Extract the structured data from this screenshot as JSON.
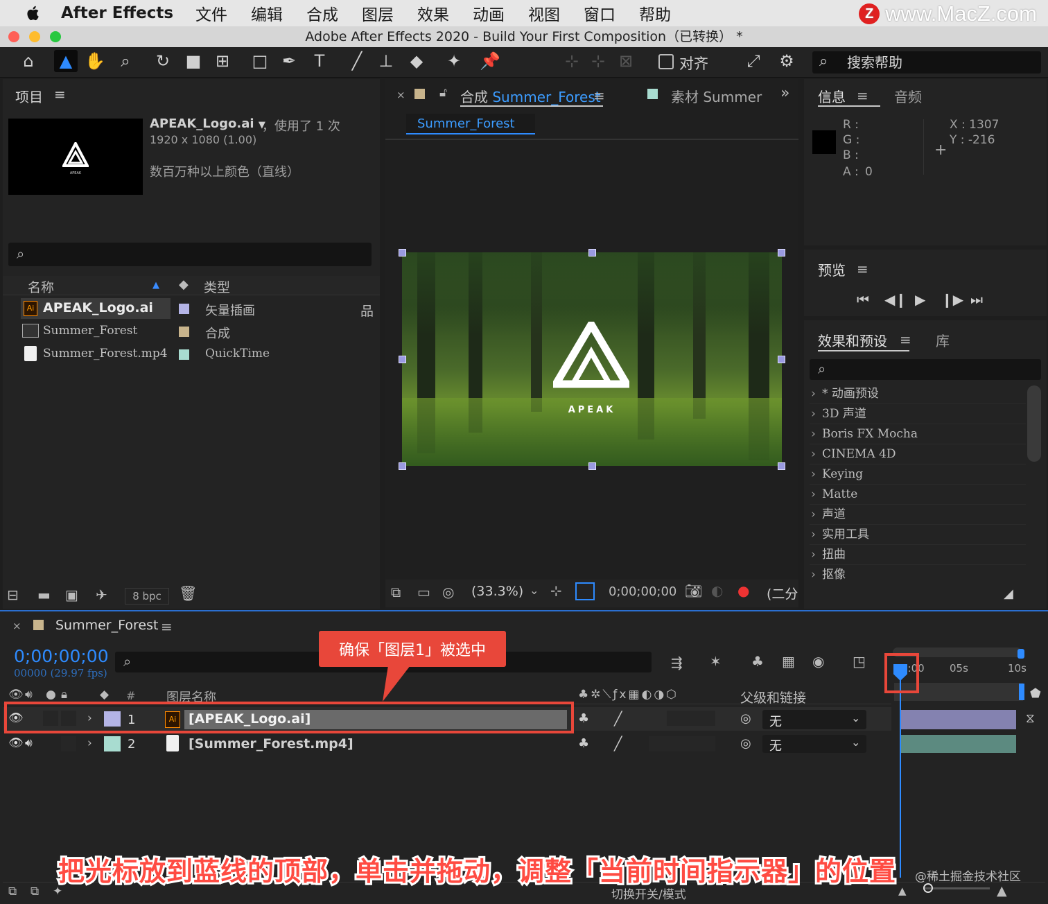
{
  "menubar": {
    "app_name": "After Effects",
    "items": [
      "文件",
      "编辑",
      "合成",
      "图层",
      "效果",
      "动画",
      "视图",
      "窗口",
      "帮助"
    ],
    "watermark": "www.MacZ.com",
    "watermark_logo": "Z"
  },
  "window": {
    "title": "Adobe After Effects 2020 - Build Your First Composition（已转换） *"
  },
  "toolbar": {
    "snap_label": "对齐",
    "search_help_label": "搜索帮助",
    "tools": [
      "home-icon",
      "selection-arrow-icon",
      "hand-icon",
      "zoom-icon",
      "rotate-icon",
      "camera-icon",
      "pan-behind-icon",
      "rectangle-icon",
      "pen-icon",
      "type-icon",
      "brush-icon",
      "clone-stamp-icon",
      "eraser-icon",
      "roto-brush-icon",
      "puppet-pin-icon"
    ]
  },
  "project_panel": {
    "title": "项目",
    "selected_item": {
      "name": "APEAK_Logo.ai",
      "usage": "，使用了 1 次",
      "dimensions": "1920 x 1080 (1.00)",
      "colors": "数百万种以上颜色（直线）",
      "thumb_text": "APEAK"
    },
    "columns": {
      "name": "名称",
      "type": "类型"
    },
    "items": [
      {
        "name": "APEAK_Logo.ai",
        "type": "矢量插画",
        "color": "#b4b4e6",
        "icon": "ai-file-icon"
      },
      {
        "name": "Summer_Forest",
        "type": "合成",
        "color": "#c8b48c",
        "icon": "composition-icon"
      },
      {
        "name": "Summer_Forest.mp4",
        "type": "QuickTime",
        "color": "#a8dcd0",
        "icon": "quicktime-icon"
      }
    ],
    "bpc_label": "8 bpc"
  },
  "composition_panel": {
    "tab_prefix": "合成",
    "tab_comp_name": "Summer_Forest",
    "footage_tab": "素材 Summer",
    "breadcrumb": "Summer_Forest",
    "logo_text": "APEAK",
    "zoom": "(33.3%)",
    "timecode": "0;00;00;00",
    "resolution": "(二分"
  },
  "info_panel": {
    "title": "信息",
    "audio_tab": "音频",
    "r_label": "R :",
    "g_label": "G :",
    "b_label": "B :",
    "a_label": "A :",
    "a_value": "0",
    "x_label": "X : 1307",
    "y_label": "Y :  -216"
  },
  "preview_panel": {
    "title": "预览"
  },
  "effects_panel": {
    "title": "效果和预设",
    "library_tab": "库",
    "items": [
      "* 动画预设",
      "3D 声道",
      "Boris FX Mocha",
      "CINEMA 4D",
      "Keying",
      "Matte",
      "声道",
      "实用工具",
      "扭曲",
      "抠像"
    ]
  },
  "timeline": {
    "comp_name": "Summer_Forest",
    "timecode": "0;00;00;00",
    "frame_info": "00000 (29.97 fps)",
    "col_hash": "#",
    "col_layer_name": "图层名称",
    "col_parent": "父级和链接",
    "ruler_marks": [
      "0:00",
      "05s",
      "10s"
    ],
    "layers": [
      {
        "num": "1",
        "name": "[APEAK_Logo.ai]",
        "parent": "无",
        "color": "#b4b4e6",
        "selected": true,
        "icon": "ai-file-icon"
      },
      {
        "num": "2",
        "name": "[Summer_Forest.mp4]",
        "parent": "无",
        "color": "#a8dcd0",
        "selected": false,
        "icon": "quicktime-icon"
      }
    ],
    "toggle_modes": "切换开关/模式"
  },
  "annotations": {
    "callout": "确保「图层1」被选中",
    "caption": "把光标放到蓝线的顶部，单击并拖动，调整「当前时间指示器」的位置",
    "corner_watermark": "@稀土掘金技术社区"
  },
  "colors": {
    "accent_blue": "#2e8bff",
    "highlight_red": "#e8473a"
  }
}
